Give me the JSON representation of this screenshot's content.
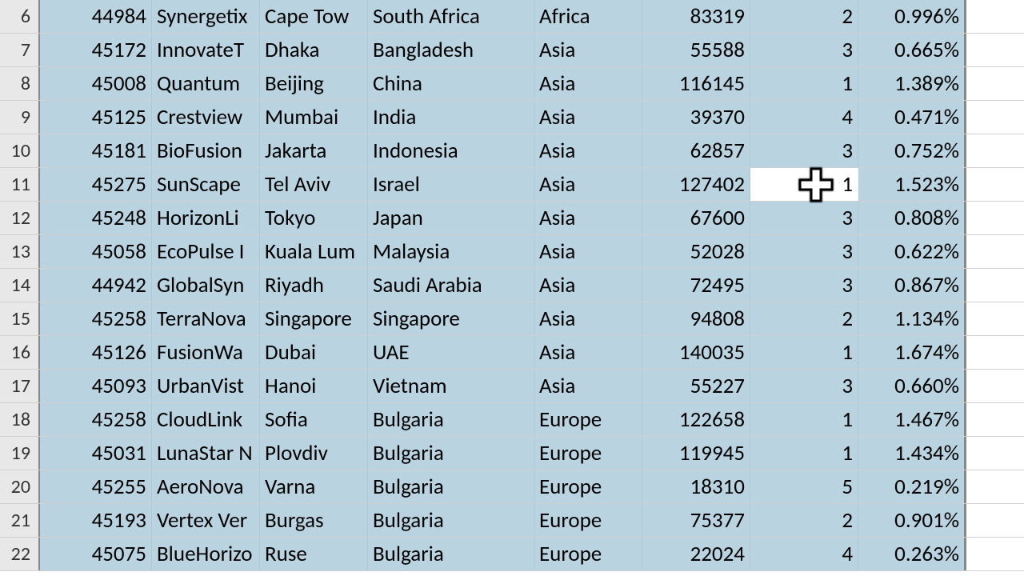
{
  "active_cell": {
    "row_index": 5,
    "col": "g"
  },
  "rows": [
    {
      "n": "6",
      "a": "44984",
      "b": "Synergetix",
      "c": "Cape Tow",
      "d": "South Africa",
      "e": "Africa",
      "f": "83319",
      "g": "2",
      "h": "0.996%"
    },
    {
      "n": "7",
      "a": "45172",
      "b": "InnovateT",
      "c": "Dhaka",
      "d": "Bangladesh",
      "e": "Asia",
      "f": "55588",
      "g": "3",
      "h": "0.665%"
    },
    {
      "n": "8",
      "a": "45008",
      "b": "Quantum",
      "c": "Beijing",
      "d": "China",
      "e": "Asia",
      "f": "116145",
      "g": "1",
      "h": "1.389%"
    },
    {
      "n": "9",
      "a": "45125",
      "b": "Crestview",
      "c": "Mumbai",
      "d": "India",
      "e": "Asia",
      "f": "39370",
      "g": "4",
      "h": "0.471%"
    },
    {
      "n": "10",
      "a": "45181",
      "b": "BioFusion",
      "c": "Jakarta",
      "d": "Indonesia",
      "e": "Asia",
      "f": "62857",
      "g": "3",
      "h": "0.752%"
    },
    {
      "n": "11",
      "a": "45275",
      "b": "SunScape",
      "c": "Tel Aviv",
      "d": "Israel",
      "e": "Asia",
      "f": "127402",
      "g": "1",
      "h": "1.523%"
    },
    {
      "n": "12",
      "a": "45248",
      "b": "HorizonLi",
      "c": "Tokyo",
      "d": "Japan",
      "e": "Asia",
      "f": "67600",
      "g": "3",
      "h": "0.808%"
    },
    {
      "n": "13",
      "a": "45058",
      "b": "EcoPulse I",
      "c": "Kuala Lum",
      "d": "Malaysia",
      "e": "Asia",
      "f": "52028",
      "g": "3",
      "h": "0.622%"
    },
    {
      "n": "14",
      "a": "44942",
      "b": "GlobalSyn",
      "c": "Riyadh",
      "d": "Saudi Arabia",
      "e": "Asia",
      "f": "72495",
      "g": "3",
      "h": "0.867%"
    },
    {
      "n": "15",
      "a": "45258",
      "b": "TerraNova",
      "c": "Singapore",
      "d": "Singapore",
      "e": "Asia",
      "f": "94808",
      "g": "2",
      "h": "1.134%"
    },
    {
      "n": "16",
      "a": "45126",
      "b": "FusionWa",
      "c": "Dubai",
      "d": "UAE",
      "e": "Asia",
      "f": "140035",
      "g": "1",
      "h": "1.674%"
    },
    {
      "n": "17",
      "a": "45093",
      "b": "UrbanVist",
      "c": "Hanoi",
      "d": "Vietnam",
      "e": "Asia",
      "f": "55227",
      "g": "3",
      "h": "0.660%"
    },
    {
      "n": "18",
      "a": "45258",
      "b": "CloudLink",
      "c": "Sofia",
      "d": "Bulgaria",
      "e": "Europe",
      "f": "122658",
      "g": "1",
      "h": "1.467%"
    },
    {
      "n": "19",
      "a": "45031",
      "b": "LunaStar N",
      "c": "Plovdiv",
      "d": "Bulgaria",
      "e": "Europe",
      "f": "119945",
      "g": "1",
      "h": "1.434%"
    },
    {
      "n": "20",
      "a": "45255",
      "b": "AeroNova",
      "c": "Varna",
      "d": "Bulgaria",
      "e": "Europe",
      "f": "18310",
      "g": "5",
      "h": "0.219%"
    },
    {
      "n": "21",
      "a": "45193",
      "b": "Vertex Ver",
      "c": "Burgas",
      "d": "Bulgaria",
      "e": "Europe",
      "f": "75377",
      "g": "2",
      "h": "0.901%"
    },
    {
      "n": "22",
      "a": "45075",
      "b": "BlueHorizo",
      "c": "Ruse",
      "d": "Bulgaria",
      "e": "Europe",
      "f": "22024",
      "g": "4",
      "h": "0.263%"
    }
  ]
}
